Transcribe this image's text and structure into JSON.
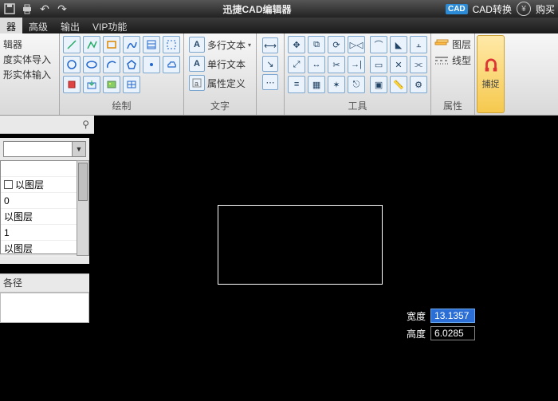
{
  "title": "迅捷CAD编辑器",
  "titlebar_right": {
    "cad_badge": "CAD",
    "convert": "CAD转换",
    "buy": "购买"
  },
  "menu": {
    "items": [
      "器",
      "高级",
      "输出",
      "VIP功能"
    ],
    "active_index": 0
  },
  "ribbon": {
    "side_left": {
      "items": [
        "辑器",
        "度实体导入",
        "形实体输入"
      ]
    },
    "draw": {
      "label": "绘制"
    },
    "text": {
      "label": "文字",
      "multi": "多行文本",
      "single": "单行文本",
      "attr": "属性定义"
    },
    "tools": {
      "label": "工具"
    },
    "attrs": {
      "label": "属性",
      "layer": "图层",
      "linetype": "线型"
    },
    "snap": {
      "label": "捕捉"
    }
  },
  "panel": {
    "pin": "⚲",
    "list": {
      "r1": "以图层",
      "r2": "0",
      "r3": "以图层",
      "r4": "1",
      "r5": "以图层"
    },
    "sec2_label": "各径"
  },
  "dims": {
    "w_label": "宽度",
    "w_val": "13.1357",
    "h_label": "高度",
    "h_val": "6.0285"
  }
}
